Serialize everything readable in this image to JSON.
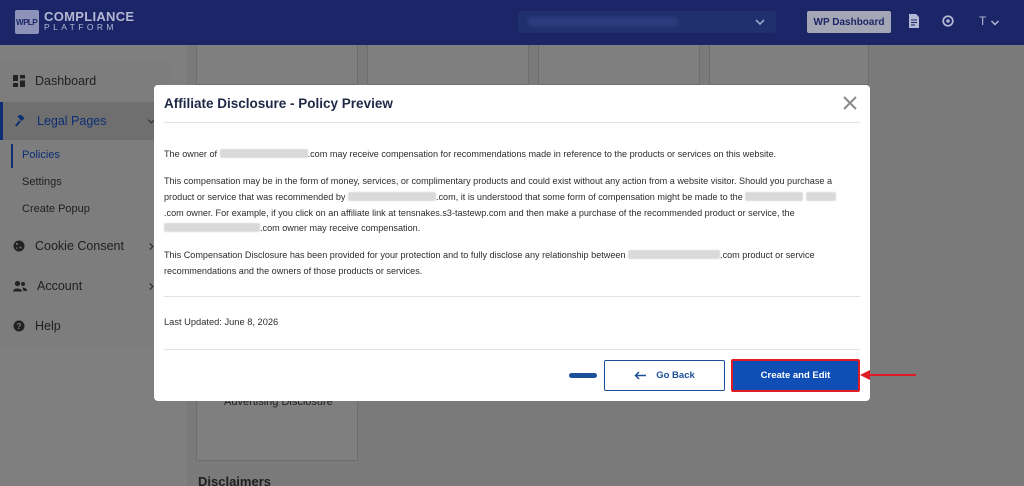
{
  "brand": {
    "mark": [
      "WP",
      "LP"
    ],
    "line1": "COMPLIANCE",
    "line2": "PLATFORM"
  },
  "header": {
    "site_selector_icon": "chevron-down-icon",
    "wp_dashboard_label": "WP Dashboard",
    "user_initial": "T",
    "icons": [
      "document-icon",
      "support-icon",
      "chevron-down-icon"
    ],
    "colors": {
      "bar": "#1b2567"
    }
  },
  "sidebar": {
    "items": [
      {
        "label": "Dashboard",
        "icon": "grid-icon"
      },
      {
        "label": "Legal Pages",
        "icon": "gavel-icon"
      },
      {
        "label": "Cookie Consent",
        "icon": "cookie-icon"
      },
      {
        "label": "Account",
        "icon": "users-icon"
      },
      {
        "label": "Help",
        "icon": "help-icon"
      }
    ],
    "subitems": [
      {
        "label": "Policies"
      },
      {
        "label": "Settings"
      },
      {
        "label": "Create Popup"
      }
    ]
  },
  "background": {
    "card_label": "Advertising Disclosure",
    "section_heading": "Disclaimers"
  },
  "modal": {
    "title": "Affiliate Disclosure - Policy Preview",
    "p1": {
      "a": "The owner of ",
      "b": ".com may receive compensation for recommendations made in reference to the products or services on this website."
    },
    "p2": {
      "a": "This compensation may be in the form of money, services, or complimentary products and could exist without any action from a website visitor. Should you purchase a product or service that was recommended by ",
      "b": ".com, it is understood that some form of compensation might be made to the ",
      "c": ".com owner. For example, if you click on an affiliate link at tensnakes.s3-tastewp.com and then make a purchase of the recommended product or service, the ",
      "d": ".com owner may receive compensation."
    },
    "p3": {
      "a": "This Compensation Disclosure has been provided for your protection and to fully disclose any relationship between ",
      "b": ".com product or service recommendations and the owners of those products or services."
    },
    "last_updated": "Last Updated: June 8, 2026",
    "go_back_label": "Go Back",
    "create_label": "Create and Edit",
    "colors": {
      "primary": "#0f4fb5",
      "highlight": "#e01b24"
    }
  }
}
